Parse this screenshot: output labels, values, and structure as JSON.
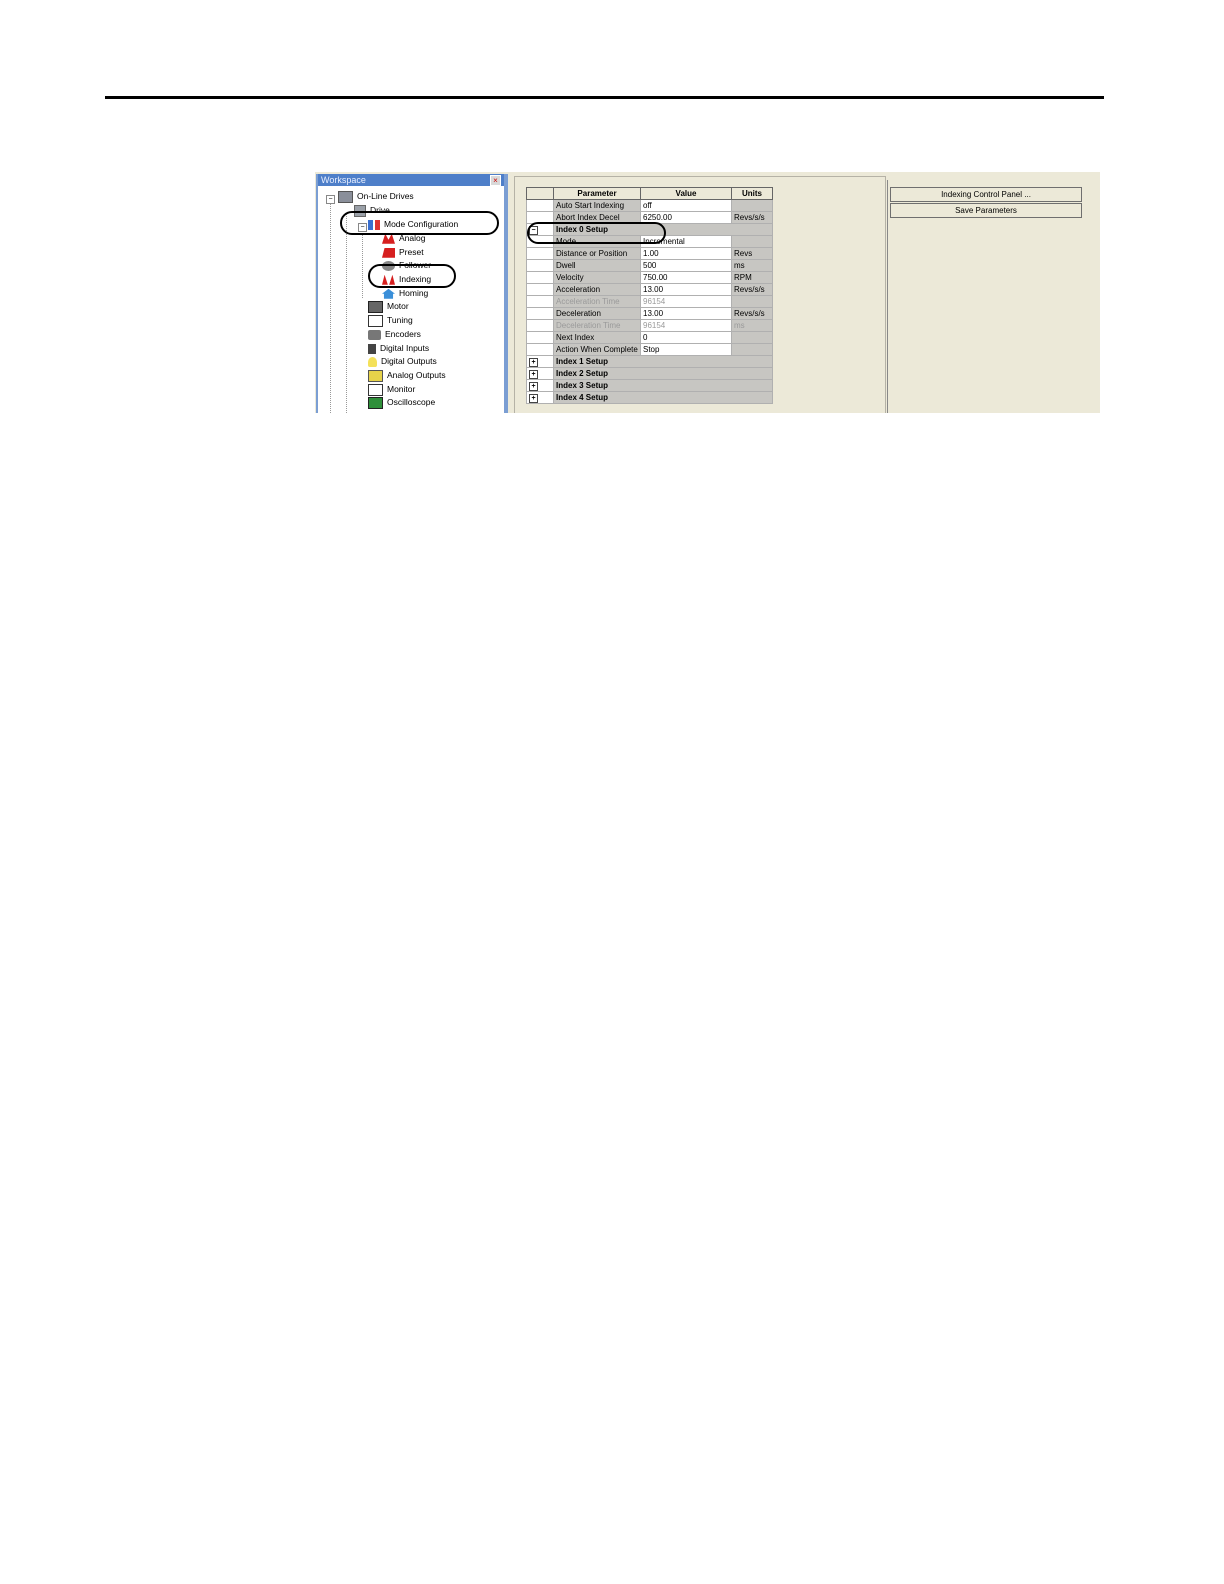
{
  "workspace": {
    "title": "Workspace",
    "close_icon": "close-icon",
    "tree": [
      {
        "label": "On-Line Drives",
        "icon": "computer-icon"
      },
      {
        "label": "Drive",
        "icon": "drive-icon"
      },
      {
        "label": "Mode Configuration",
        "icon": "mode-config-icon"
      },
      {
        "label": "Analog",
        "icon": "analog-icon"
      },
      {
        "label": "Preset",
        "icon": "preset-icon"
      },
      {
        "label": "Follower",
        "icon": "follower-icon"
      },
      {
        "label": "Indexing",
        "icon": "indexing-icon"
      },
      {
        "label": "Homing",
        "icon": "homing-icon"
      },
      {
        "label": "Motor",
        "icon": "motor-icon"
      },
      {
        "label": "Tuning",
        "icon": "tuning-icon"
      },
      {
        "label": "Encoders",
        "icon": "encoders-icon"
      },
      {
        "label": "Digital Inputs",
        "icon": "digital-inputs-icon"
      },
      {
        "label": "Digital Outputs",
        "icon": "digital-outputs-icon"
      },
      {
        "label": "Analog Outputs",
        "icon": "analog-outputs-icon"
      },
      {
        "label": "Monitor",
        "icon": "monitor-icon"
      },
      {
        "label": "Oscilloscope",
        "icon": "oscilloscope-icon"
      }
    ]
  },
  "grid": {
    "headers": [
      "Parameter",
      "Value",
      "Units"
    ],
    "rows": [
      {
        "param": "Auto Start Indexing",
        "value": "off",
        "units": ""
      },
      {
        "param": "Abort Index Decel",
        "value": "6250.00",
        "units": "Revs/s/s"
      },
      {
        "section": "Index 0 Setup",
        "expander": "−"
      },
      {
        "param": "Mode",
        "value": "Incremental",
        "units": ""
      },
      {
        "param": "Distance or Position",
        "value": "1.00",
        "units": "Revs"
      },
      {
        "param": "Dwell",
        "value": "500",
        "units": "ms"
      },
      {
        "param": "Velocity",
        "value": "750.00",
        "units": "RPM"
      },
      {
        "param": "Acceleration",
        "value": "13.00",
        "units": "Revs/s/s"
      },
      {
        "param": "Acceleration Time",
        "value": "96154",
        "units": "",
        "dim": true
      },
      {
        "param": "Deceleration",
        "value": "13.00",
        "units": "Revs/s/s"
      },
      {
        "param": "Deceleration Time",
        "value": "96154",
        "units": "ms",
        "dim": true
      },
      {
        "param": "Next Index",
        "value": "0",
        "units": ""
      },
      {
        "param": "Action When Complete",
        "value": "Stop",
        "units": ""
      },
      {
        "section": "Index 1 Setup",
        "expander": "+"
      },
      {
        "section": "Index 2 Setup",
        "expander": "+"
      },
      {
        "section": "Index 3 Setup",
        "expander": "+"
      },
      {
        "section": "Index 4 Setup",
        "expander": "+"
      }
    ]
  },
  "buttons": {
    "indexing_control": "Indexing Control Panel ...",
    "save_params": "Save Parameters"
  },
  "scroll": {
    "up_arrow": "^"
  }
}
